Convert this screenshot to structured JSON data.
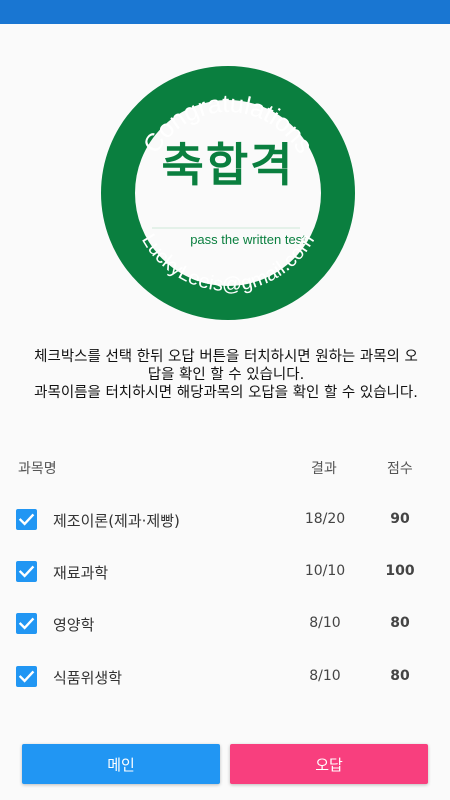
{
  "colors": {
    "status_bar": "#1976d2",
    "stamp_green": "#0a7f3f",
    "checkbox": "#2196f3",
    "main_button": "#2196f3",
    "wrong_button": "#f83f7e"
  },
  "stamp": {
    "top_text": "Congratulations",
    "center_text": "축합격",
    "sub_text": "pass the written test",
    "bottom_text": "LuckyLeeis@gmail.com"
  },
  "instructions": {
    "line1": "체크박스를 선택 한뒤 오답 버튼을 터치하시면 원하는 과목의 오답을 확인 할 수 있습니다.",
    "line2": "과목이름을 터치하시면 해당과목의 오답을 확인 할 수 있습니다."
  },
  "table": {
    "header_name": "과목명",
    "header_result": "결과",
    "header_score": "점수",
    "rows": [
      {
        "name": "제조이론(제과·제빵)",
        "result": "18/20",
        "score": "90",
        "checked": true,
        "check_icon": "checkmark-icon"
      },
      {
        "name": "재료과학",
        "result": "10/10",
        "score": "100",
        "checked": true,
        "check_icon": "checkmark-icon"
      },
      {
        "name": "영양학",
        "result": "8/10",
        "score": "80",
        "checked": true,
        "check_icon": "checkmark-icon"
      },
      {
        "name": "식품위생학",
        "result": "8/10",
        "score": "80",
        "checked": true,
        "check_icon": "checkmark-icon"
      }
    ]
  },
  "buttons": {
    "main_label": "메인",
    "wrong_label": "오답"
  }
}
